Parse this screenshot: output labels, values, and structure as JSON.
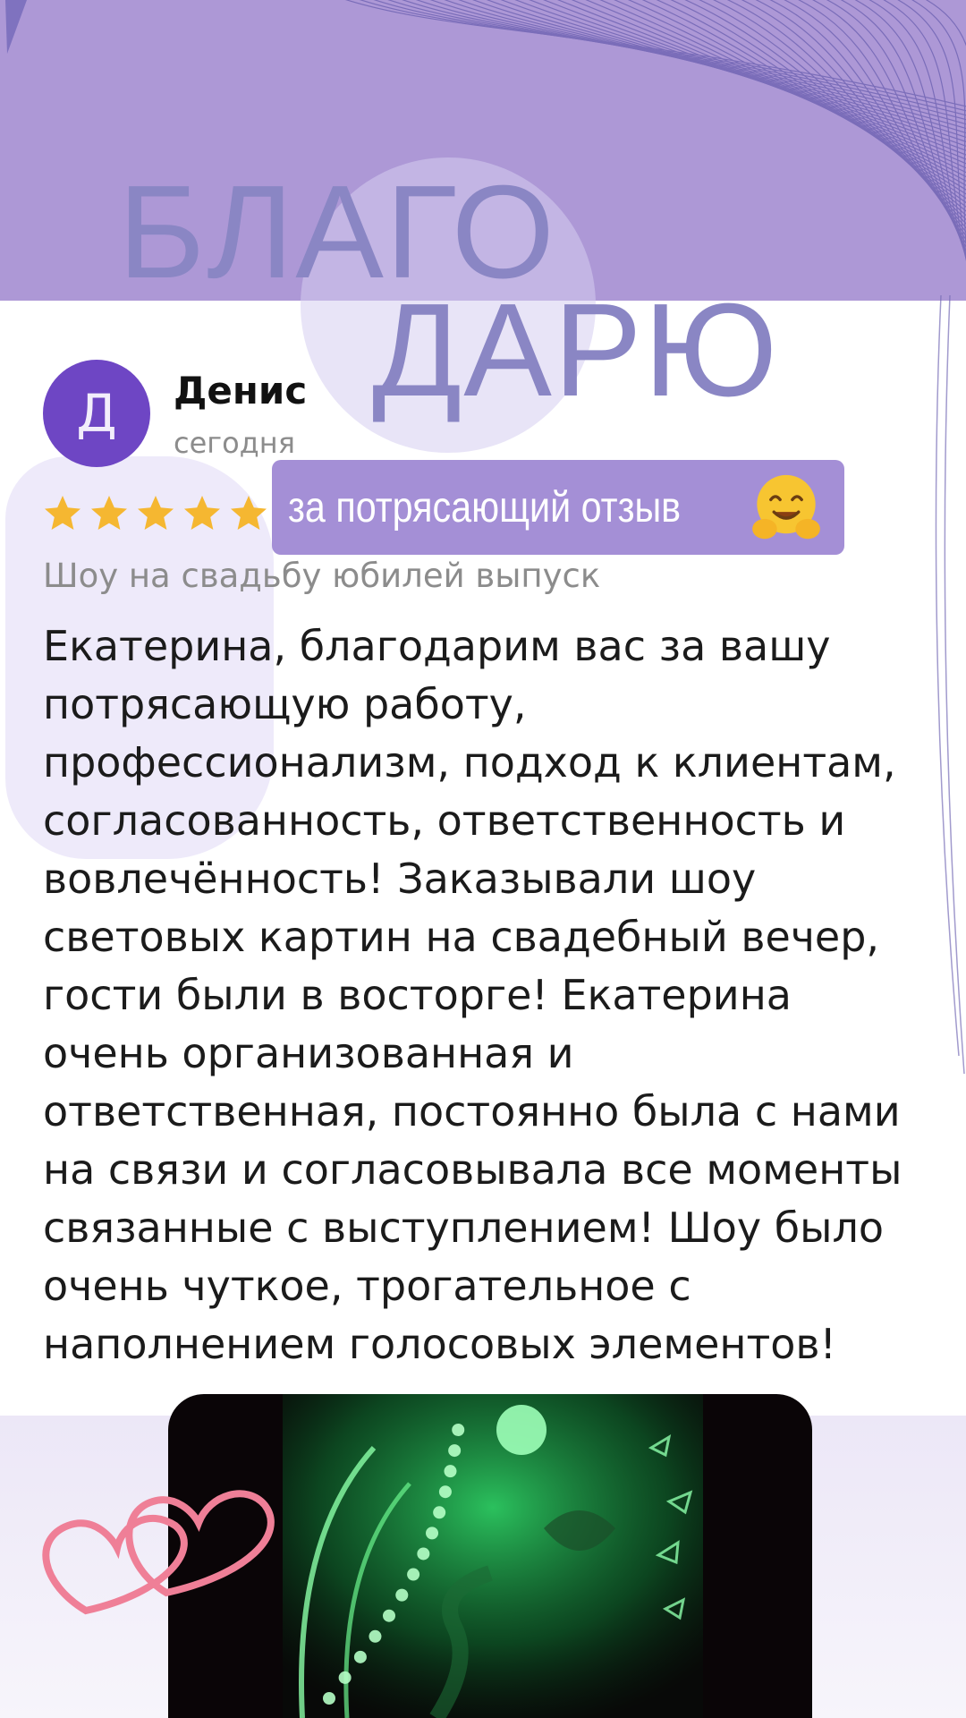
{
  "colors": {
    "top_band": "#ad98d6",
    "big_word": "#8a86c4",
    "avatar_bg": "#6e46c4",
    "banner_bg": "#a48fd6",
    "star": "#f5b731",
    "heart": "#ef7f97",
    "glow_green": "#36ff7a"
  },
  "headline": {
    "line1": "БЛАГО",
    "line2": "ДАРЮ"
  },
  "banner": {
    "text": "за потрясающий отзыв",
    "emoji_icon": "hugging-face-icon"
  },
  "review": {
    "avatar_letter": "Д",
    "author": "Денис",
    "date": "сегодня",
    "rating": 5,
    "service": "Шоу на свадьбу юбилей выпуск",
    "text_lines": [
      "Екатерина, благодарим вас за вашу",
      "потрясающую работу,",
      "профессионализм, подход к клиентам,",
      "согласованность, ответственность и",
      "вовлечённость! Заказывали шоу",
      "световых картин на свадебный вечер,",
      "гости были в восторге! Екатерина",
      "очень организованная и",
      "ответственная, постоянно была с нами",
      "на связи и согласовывала все моменты",
      "связанные с выступлением! Шоу было",
      "очень чуткое, трогательное с",
      "наполнением голосовых элементов!"
    ]
  },
  "decor": {
    "hearts_icon": "double-heart-outline-icon",
    "photo": "glowing-light-painting-photo"
  }
}
